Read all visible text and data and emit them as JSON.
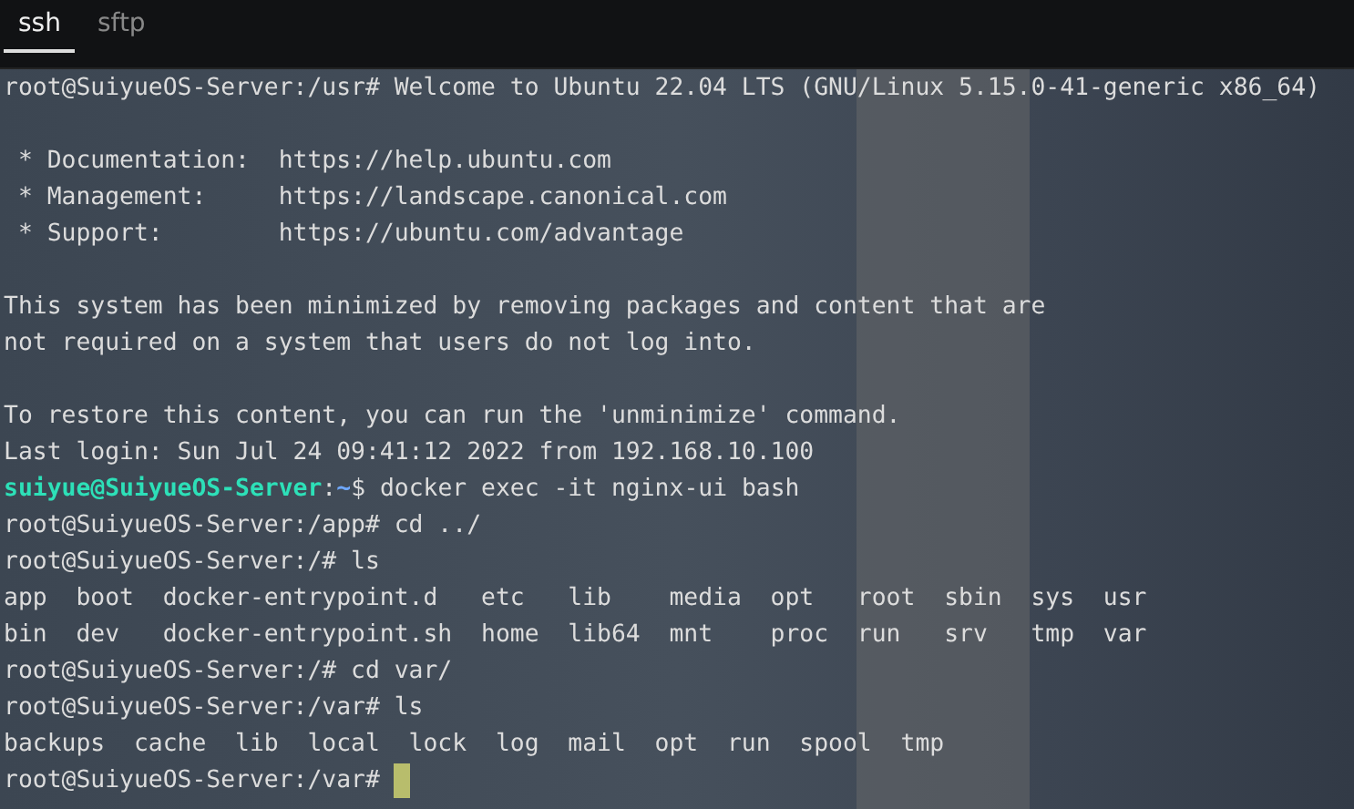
{
  "tabs": [
    {
      "label": "ssh",
      "selected": true
    },
    {
      "label": "sftp",
      "selected": false
    }
  ],
  "terminal": {
    "lines": [
      {
        "kind": "text",
        "text": "root@SuiyueOS-Server:/usr# Welcome to Ubuntu 22.04 LTS (GNU/Linux 5.15.0-41-generic x86_64)"
      },
      {
        "kind": "blank"
      },
      {
        "kind": "text",
        "text": " * Documentation:  https://help.ubuntu.com"
      },
      {
        "kind": "text",
        "text": " * Management:     https://landscape.canonical.com"
      },
      {
        "kind": "text",
        "text": " * Support:        https://ubuntu.com/advantage"
      },
      {
        "kind": "blank"
      },
      {
        "kind": "text",
        "text": "This system has been minimized by removing packages and content that are"
      },
      {
        "kind": "text",
        "text": "not required on a system that users do not log into."
      },
      {
        "kind": "blank"
      },
      {
        "kind": "text",
        "text": "To restore this content, you can run the 'unminimize' command."
      },
      {
        "kind": "text",
        "text": "Last login: Sun Jul 24 09:41:12 2022 from 192.168.10.100"
      },
      {
        "kind": "user_prompt",
        "user_host": "suiyue@SuiyueOS-Server",
        "separator": ":",
        "path": "~",
        "command": "$ docker exec -it nginx-ui bash"
      },
      {
        "kind": "text",
        "text": "root@SuiyueOS-Server:/app# cd ../"
      },
      {
        "kind": "text",
        "text": "root@SuiyueOS-Server:/# ls"
      },
      {
        "kind": "text",
        "text": "app  boot  docker-entrypoint.d   etc   lib    media  opt   root  sbin  sys  usr"
      },
      {
        "kind": "text",
        "text": "bin  dev   docker-entrypoint.sh  home  lib64  mnt    proc  run   srv   tmp  var"
      },
      {
        "kind": "text",
        "text": "root@SuiyueOS-Server:/# cd var/"
      },
      {
        "kind": "text",
        "text": "root@SuiyueOS-Server:/var# ls"
      },
      {
        "kind": "text",
        "text": "backups  cache  lib  local  lock  log  mail  opt  run  spool  tmp"
      },
      {
        "kind": "text",
        "text": "root@SuiyueOS-Server:/var# ",
        "cursor": true
      }
    ]
  }
}
